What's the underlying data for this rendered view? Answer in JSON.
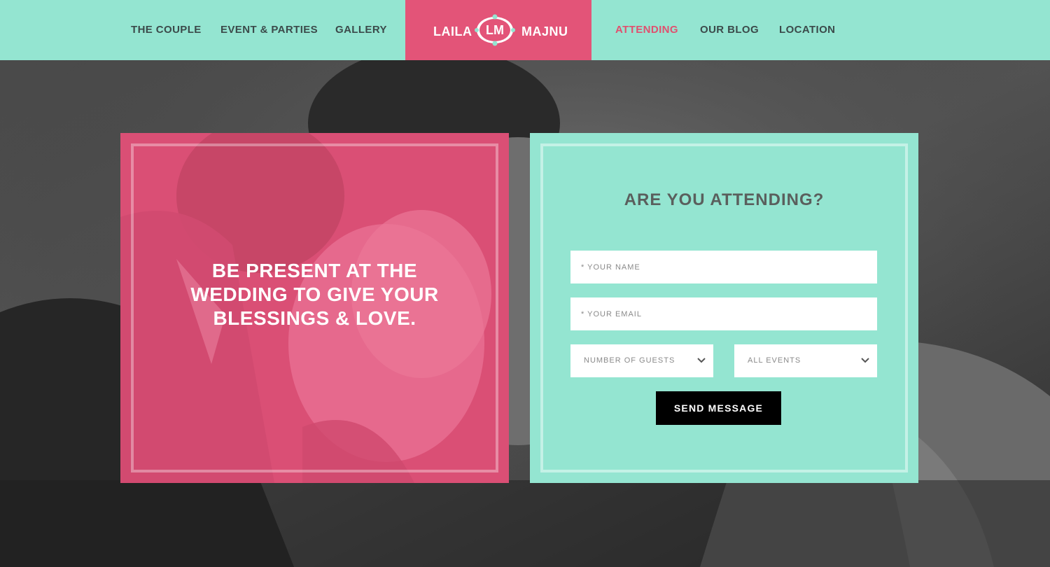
{
  "nav": {
    "left": [
      {
        "label": "THE COUPLE"
      },
      {
        "label": "EVENT & PARTIES"
      },
      {
        "label": "GALLERY"
      }
    ],
    "right": [
      {
        "label": "ATTENDING",
        "active": true
      },
      {
        "label": "OUR BLOG"
      },
      {
        "label": "LOCATION"
      }
    ]
  },
  "logo": {
    "left_name": "LAILA",
    "monogram": "LM",
    "right_name": "MAJNU"
  },
  "hero": {
    "tagline": "BE PRESENT AT THE WEDDING TO GIVE YOUR BLESSINGS & LOVE."
  },
  "rsvp": {
    "title": "ARE YOU ATTENDING?",
    "name_placeholder": "* YOUR NAME",
    "email_placeholder": "* YOUR EMAIL",
    "guests_label": "NUMBER OF GUESTS",
    "events_label": "ALL EVENTS",
    "send_label": "SEND MESSAGE"
  },
  "colors": {
    "mint": "#94e5d1",
    "pink": "#e35478",
    "active_link": "#e0506f",
    "nav_text": "#3b4a4a",
    "button": "#000000"
  },
  "icons": {
    "select_arrow": "chevron-down-icon",
    "monogram_frame": "ornate-frame-icon"
  }
}
